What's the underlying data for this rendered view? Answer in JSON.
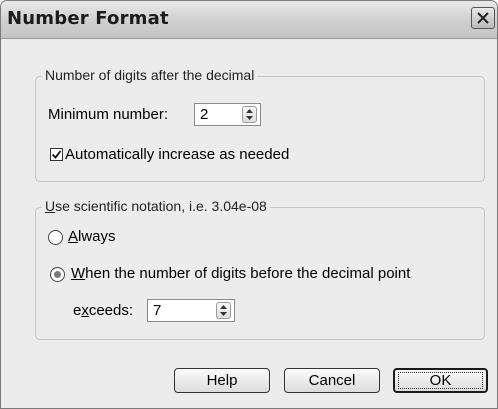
{
  "dialog": {
    "title": "Number Format"
  },
  "digits_group": {
    "legend": "Number of digits after the decimal",
    "min_label": "Minimum number:",
    "min_value": "2",
    "auto_increase_label": "Automatically increase as needed",
    "auto_increase_checked": true
  },
  "sci_group": {
    "legend_prefix": "U",
    "legend_rest": "se scientific notation,  i.e. 3.04e-08",
    "always_prefix": "A",
    "always_rest": "lways",
    "when_prefix": "W",
    "when_rest": "hen the number of digits before the decimal point",
    "exceeds_a": "e",
    "exceeds_u": "x",
    "exceeds_b": "ceeds:",
    "exceeds_value": "7",
    "selected_option": "when"
  },
  "buttons": {
    "help": "Help",
    "cancel": "Cancel",
    "ok": "OK"
  },
  "icons": {
    "close": "close-icon",
    "spin": "spin-arrows-icon",
    "check": "checkmark-icon"
  }
}
